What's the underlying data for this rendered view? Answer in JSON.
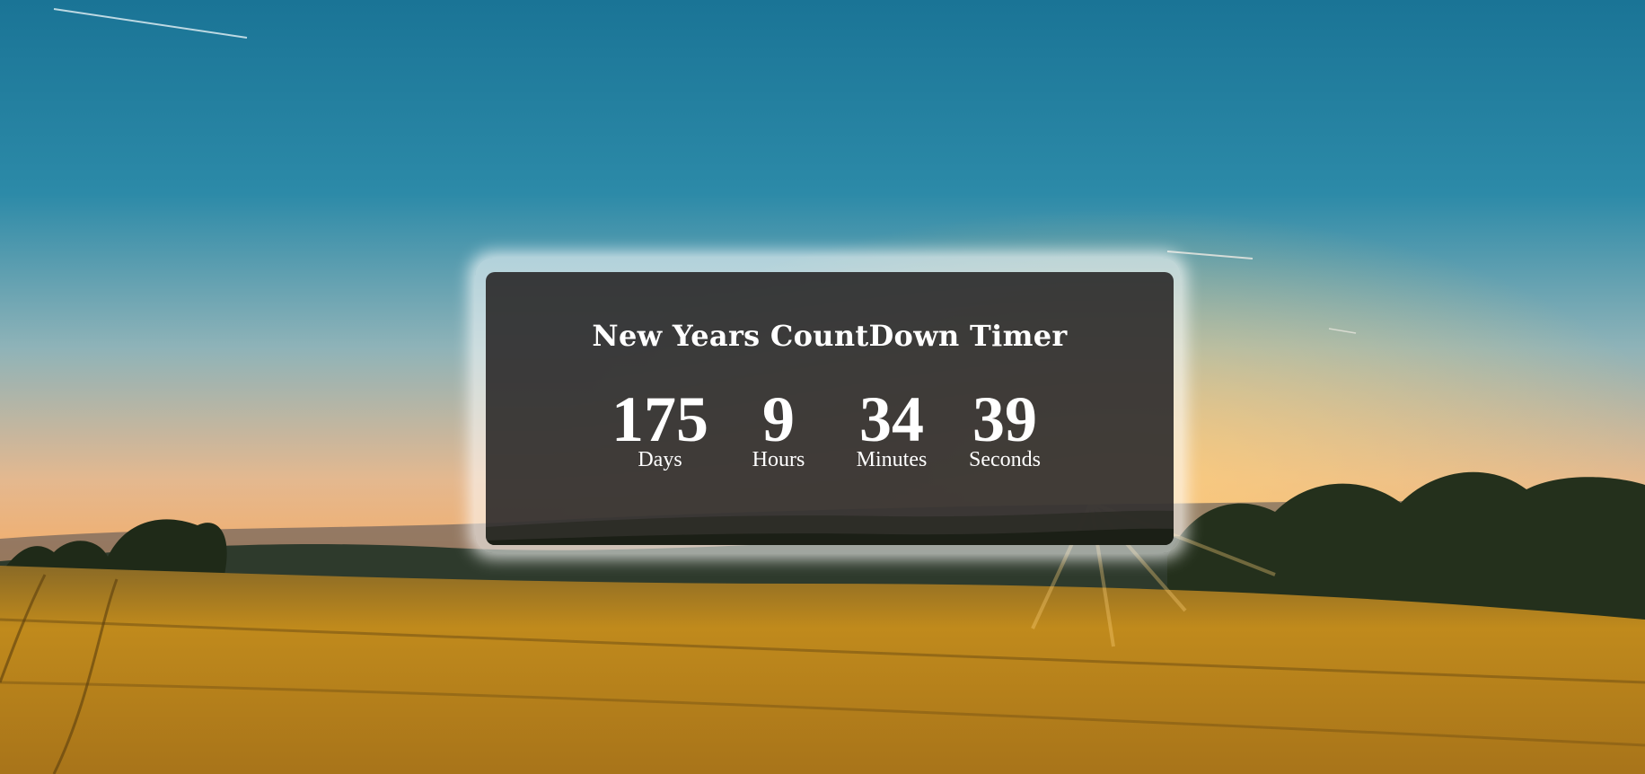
{
  "page": {
    "title": "New Years CountDown Timer"
  },
  "countdown": {
    "units": [
      {
        "value": "175",
        "label": "Days"
      },
      {
        "value": "9",
        "label": "Hours"
      },
      {
        "value": "34",
        "label": "Minutes"
      },
      {
        "value": "39",
        "label": "Seconds"
      }
    ]
  },
  "colors": {
    "sky_top": "#1f7fa0",
    "sky_horizon": "#f4b46f",
    "field": "#c9951c",
    "card_bg": "#222020",
    "text": "#ffffff"
  }
}
